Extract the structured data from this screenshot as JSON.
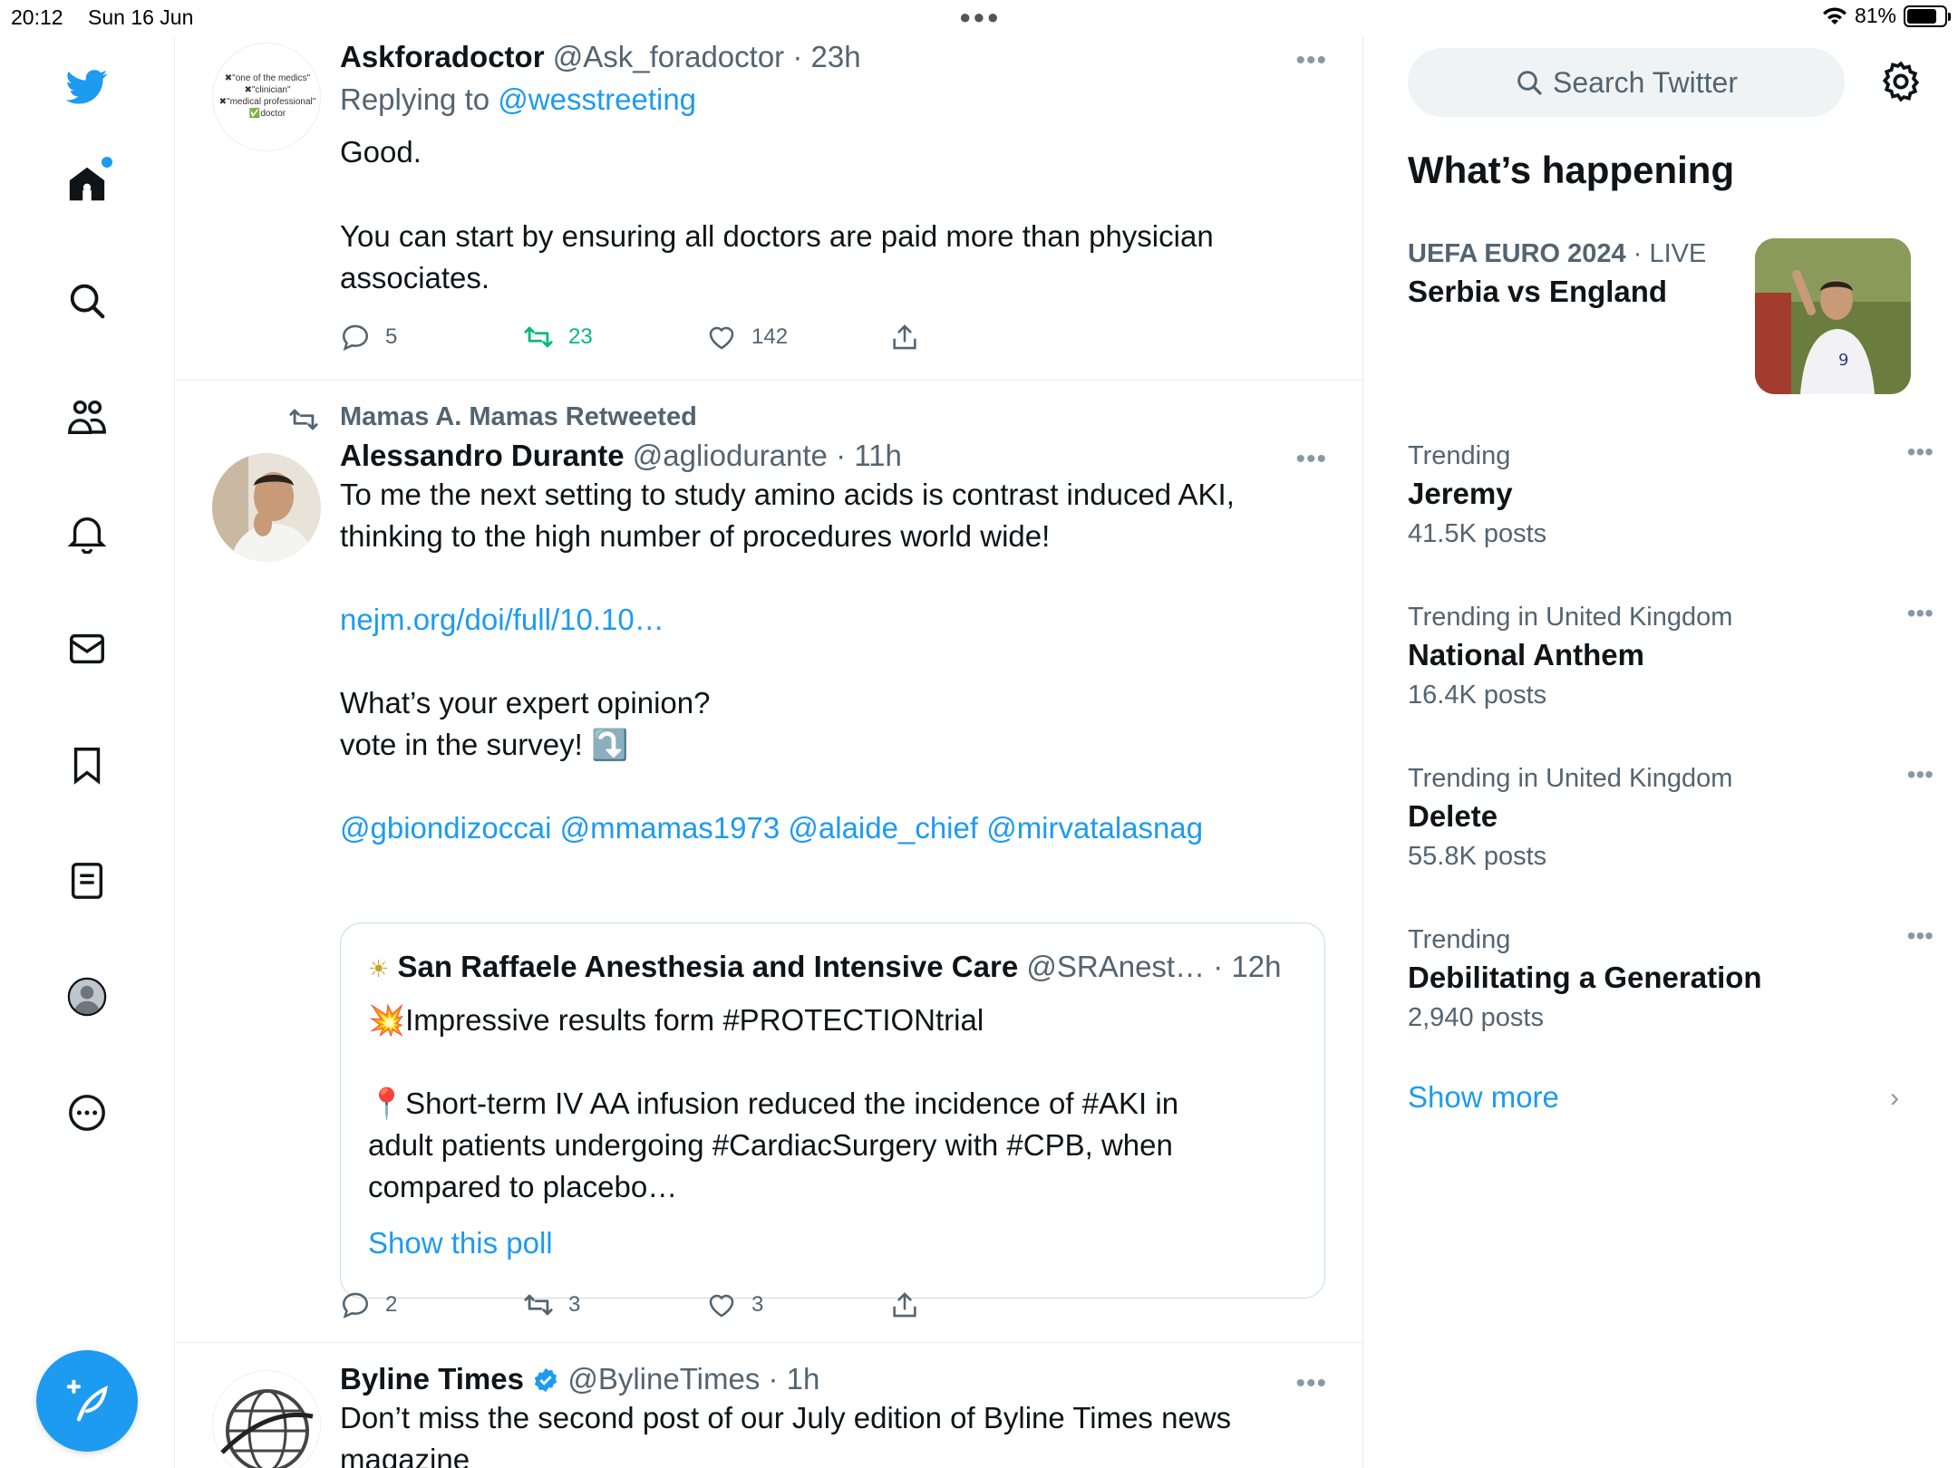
{
  "statusbar": {
    "time": "20:12",
    "date": "Sun 16 Jun",
    "battery": "81%",
    "battery_level": 0.81
  },
  "nav": {
    "items": [
      "twitter-logo",
      "home-icon",
      "search-icon",
      "communities-icon",
      "notifications-icon",
      "messages-icon",
      "bookmarks-icon",
      "lists-icon",
      "profile-icon",
      "more-icon"
    ],
    "compose_icon": "compose-icon"
  },
  "tweets": [
    {
      "name": "Askforadoctor",
      "handle": "@Ask_foradoctor",
      "sep": "·",
      "time": "23h",
      "reply_prefix": "Replying to",
      "reply_handle": "@wesstreeting",
      "body_1": "Good.",
      "body_2": "You can start by ensuring all doctors are paid more than physician",
      "body_3": "associates.",
      "avatar_lines": [
        "✖\"one of the medics\"",
        "✖\"clinician\"",
        "✖\"medical professional\"",
        "✅doctor"
      ],
      "replies": "5",
      "retweets": "23",
      "likes": "142"
    },
    {
      "retweeted_by": "Mamas A. Mamas Retweeted",
      "name": "Alessandro Durante",
      "handle": "@agliodurante",
      "sep": "·",
      "time": "11h",
      "body_1": "To me the next setting to study amino acids is contrast induced AKI,",
      "body_2": "thinking to the high number of procedures world wide!",
      "link": "nejm.org/doi/full/10.10…",
      "body_3": "What’s your expert opinion?",
      "body_4": "vote in the survey! ⤵️",
      "mentions": "@gbiondizoccai @mmamas1973 @alaide_chief @mirvatalasnag",
      "quote": {
        "name": "San Raffaele Anesthesia and Intensive Care",
        "handle": "@SRAnest…",
        "sep": "·",
        "time": "12h",
        "line_1": "💥Impressive results form #PROTECTIONtrial",
        "line_2": "📍Short-term IV AA infusion reduced the incidence of #AKI in",
        "line_3": "adult patients undergoing #CardiacSurgery with #CPB, when",
        "line_4": "compared to placebo…",
        "poll_link": "Show this poll"
      },
      "replies": "2",
      "retweets": "3",
      "likes": "3"
    },
    {
      "name": "Byline Times",
      "handle": "@BylineTimes",
      "sep": "·",
      "time": "1h",
      "body_1": "Don’t miss the second post of our July edition of Byline Times news",
      "body_2": "magazine"
    }
  ],
  "sidebar": {
    "search_placeholder": "Search Twitter",
    "whats_happening": "What’s happening",
    "euro": {
      "context": "UEFA EURO 2024",
      "sep": " · ",
      "live": "LIVE",
      "title": "Serbia vs England"
    },
    "trends": [
      {
        "context": "Trending",
        "topic": "Jeremy",
        "count": "41.5K posts"
      },
      {
        "context": "Trending in United Kingdom",
        "topic": "National Anthem",
        "count": "16.4K posts"
      },
      {
        "context": "Trending in United Kingdom",
        "topic": "Delete",
        "count": "55.8K posts"
      },
      {
        "context": "Trending",
        "topic": "Debilitating a Generation",
        "count": "2,940 posts"
      }
    ],
    "show_more": "Show more"
  },
  "colors": {
    "accent": "#1d9bf0",
    "retweet_green": "#00ba7c",
    "muted": "#536471",
    "border": "#e6ecf0"
  }
}
